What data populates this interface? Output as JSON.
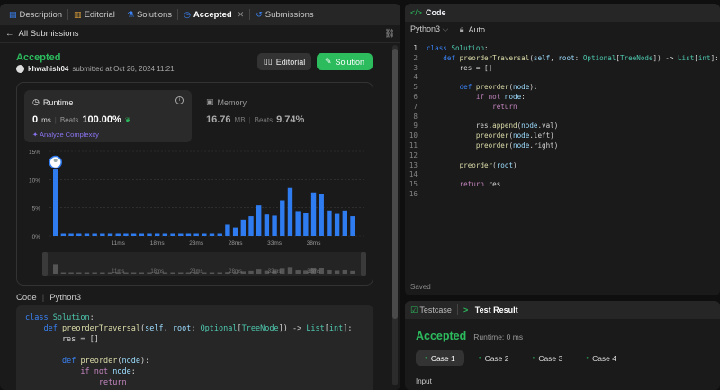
{
  "left_tabs": [
    {
      "label": "Description",
      "icon": "description-icon"
    },
    {
      "label": "Editorial",
      "icon": "book-icon"
    },
    {
      "label": "Solutions",
      "icon": "flask-icon"
    },
    {
      "label": "Accepted",
      "icon": "clock-icon"
    },
    {
      "label": "Submissions",
      "icon": "history-icon"
    }
  ],
  "subbar": {
    "back_label": "All Submissions"
  },
  "submission": {
    "status": "Accepted",
    "user": "khwahish04",
    "submitted_text": "submitted at Oct 26, 2024 11:21",
    "editorial_label": "Editorial",
    "solution_label": "Solution"
  },
  "runtime": {
    "title": "Runtime",
    "value": "0",
    "unit": "ms",
    "beats_label": "Beats",
    "beats": "100.00%",
    "analyze": "Analyze Complexity"
  },
  "memory": {
    "title": "Memory",
    "value": "16.76",
    "unit": "MB",
    "beats_label": "Beats",
    "beats": "9.74%"
  },
  "chart_data": {
    "type": "bar",
    "y_ticks": [
      "15%",
      "10%",
      "5%",
      "0%"
    ],
    "ylim": [
      0,
      15
    ],
    "x_tick_labels": [
      "11ms",
      "18ms",
      "23ms",
      "28ms",
      "33ms",
      "38ms"
    ],
    "values": [
      11.8,
      0.4,
      0.4,
      0.4,
      0.4,
      0.4,
      0.4,
      0.4,
      0.4,
      0.4,
      0.4,
      0.4,
      0.4,
      0.4,
      0.4,
      0.4,
      0.4,
      0.4,
      0.4,
      0.4,
      0.4,
      0.4,
      2.0,
      1.5,
      2.9,
      3.5,
      5.4,
      3.8,
      3.6,
      6.3,
      8.5,
      4.4,
      4.0,
      7.7,
      7.5,
      4.5,
      3.9,
      4.5,
      3.5
    ],
    "highlight_index": 0,
    "colors": {
      "bar": "#2f7bf0",
      "grid": "#3a3a3a",
      "mini_bar": "#555555"
    }
  },
  "code_section": {
    "label": "Code",
    "lang": "Python3"
  },
  "mini_code_lines": [
    "class Solution:",
    "    def preorderTraversal(self, root: Optional[TreeNode]) -> List[int]:",
    "        res = []",
    "",
    "        def preorder(node):",
    "            if not node:",
    "                return"
  ],
  "editor": {
    "title": "Code",
    "lang": "Python3",
    "mode": "Auto",
    "saved": "Saved",
    "lines": [
      "class Solution:",
      "    def preorderTraversal(self, root: Optional[TreeNode]) -> List[int]:",
      "        res = []",
      "",
      "        def preorder(node):",
      "            if not node:",
      "                return",
      "",
      "            res.append(node.val)",
      "            preorder(node.left)",
      "            preorder(node.right)",
      "",
      "        preorder(root)",
      "",
      "        return res",
      ""
    ]
  },
  "testpanel": {
    "testcase_label": "Testcase",
    "result_label": "Test Result",
    "status": "Accepted",
    "runtime": "Runtime: 0 ms",
    "cases": [
      "Case 1",
      "Case 2",
      "Case 3",
      "Case 4"
    ],
    "input_label": "Input"
  }
}
